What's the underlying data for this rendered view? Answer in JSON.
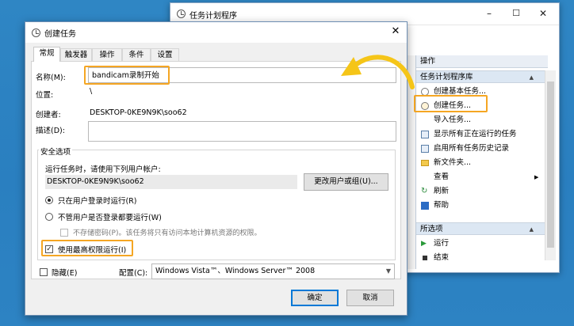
{
  "task_scheduler": {
    "title": "任务计划程序",
    "window_buttons": {
      "minimize": "–",
      "maximize": "☐",
      "close": "✕"
    },
    "actions_header": "操作",
    "library_section": "任务计划程序库",
    "library_items": [
      {
        "label": "创建基本任务...",
        "icon": "basic-task-icon"
      },
      {
        "label": "创建任务...",
        "icon": "create-task-icon"
      },
      {
        "label": "导入任务...",
        "icon": ""
      },
      {
        "label": "显示所有正在运行的任务",
        "icon": "running-tasks-icon"
      },
      {
        "label": "启用所有任务历史记录",
        "icon": "history-icon"
      },
      {
        "label": "新文件夹...",
        "icon": "folder-icon"
      },
      {
        "label": "查看",
        "icon": ""
      },
      {
        "label": "刷新",
        "icon": "refresh-icon"
      },
      {
        "label": "帮助",
        "icon": "help-icon"
      }
    ],
    "selected_section": "所选项",
    "selected_items": [
      {
        "label": "运行",
        "icon": "run-icon"
      },
      {
        "label": "结束",
        "icon": "stop-icon"
      }
    ]
  },
  "dialog": {
    "title": "创建任务",
    "close": "✕",
    "tabs": [
      "常规",
      "触发器",
      "操作",
      "条件",
      "设置"
    ],
    "name_label": "名称(M):",
    "name_value": "bandicam录制开始",
    "location_label": "位置:",
    "location_value": "\\",
    "author_label": "创建者:",
    "author_value": "DESKTOP-0KE9N9K\\soo62",
    "description_label": "描述(D):",
    "description_value": "",
    "security_label": "安全选项",
    "run_as_label": "运行任务时，请使用下列用户帐户:",
    "run_as_value": "DESKTOP-0KE9N9K\\soo62",
    "change_user_button": "更改用户或组(U)...",
    "radio_logged_on": "只在用户登录时运行(R)",
    "radio_whether": "不管用户是否登录都要运行(W)",
    "no_store_password": "不存储密码(P)。该任务将只有访问本地计算机资源的权限。",
    "highest_privileges": "使用最高权限运行(I)",
    "hidden_label": "隐藏(E)",
    "configure_label": "配置(C):",
    "configure_value": "Windows Vista™、Windows Server™ 2008",
    "ok_button": "确定",
    "cancel_button": "取消"
  },
  "colors": {
    "accent": "#f5a623",
    "desktop": "#2a7fc0",
    "section_bg": "#dce7f3"
  }
}
